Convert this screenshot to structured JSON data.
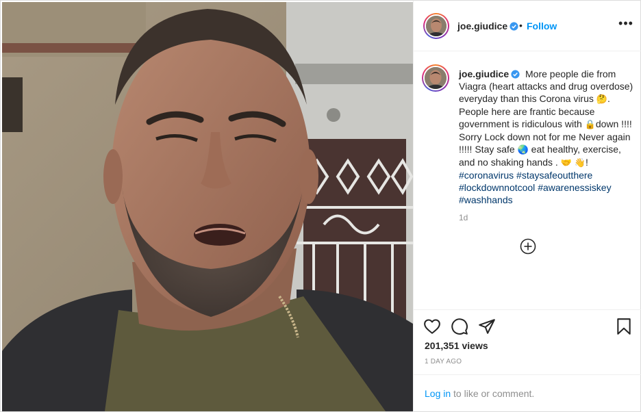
{
  "post": {
    "username": "joe.giudice",
    "verified": true,
    "header": {
      "separator": "•",
      "follow_label": "Follow",
      "more_icon": "more-options-icon",
      "more_label": "•••"
    },
    "caption": {
      "username": "joe.giudice",
      "part1": "More people die from Viagra (heart attacks and drug overdose) everyday than this Corona virus ",
      "emoji_1": "🤔",
      "part2": ". People here are frantic because government is ridiculous with ",
      "emoji_lock": "🔒",
      "part3": "down !!!! Sorry Lock down not for me Never again !!!!! Stay safe ",
      "emoji_globe": "🌏",
      "part4": " eat healthy, exercise, and no shaking hands . ",
      "emoji_3": "🤝",
      "emoji_wave": "👋",
      "part5": "! ",
      "hashtags": [
        "#coronavirus",
        "#staysafeoutthere",
        "#lockdownnotcool",
        "#awarenessiskey",
        "#washhands"
      ],
      "age": "1d"
    },
    "load_more_icon": "plus-circle-icon",
    "actions": {
      "icons": [
        "heart-icon",
        "comment-icon",
        "share-icon",
        "bookmark-icon"
      ]
    },
    "views": "201,351 views",
    "timestamp": "1 DAY AGO",
    "login": {
      "link_label": "Log in",
      "rest": " to like or comment."
    },
    "colors": {
      "link_blue": "#0095f6",
      "hashtag_blue": "#00376b",
      "muted_gray": "#8e8e8e",
      "text": "#262626",
      "border": "#dbdbdb"
    }
  }
}
